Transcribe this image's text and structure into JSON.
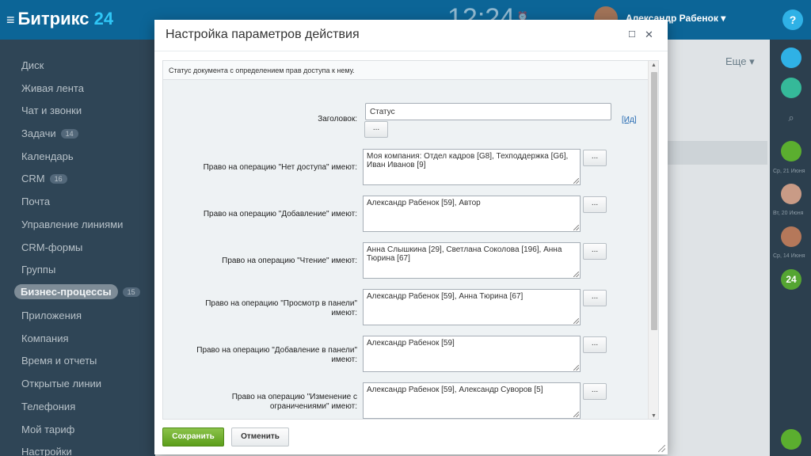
{
  "app": {
    "logo_text": "Битрикс",
    "logo_num": "24",
    "clock": "12:24",
    "user_name": "Александр Рабенок",
    "help": "?",
    "more_label": "Еще"
  },
  "sidebar": {
    "items": [
      {
        "label": "Диск",
        "badge": ""
      },
      {
        "label": "Живая лента",
        "badge": ""
      },
      {
        "label": "Чат и звонки",
        "badge": ""
      },
      {
        "label": "Задачи",
        "badge": "14"
      },
      {
        "label": "Календарь",
        "badge": ""
      },
      {
        "label": "CRM",
        "badge": "16"
      },
      {
        "label": "Почта",
        "badge": ""
      },
      {
        "label": "Управление линиями",
        "badge": ""
      },
      {
        "label": "CRM-формы",
        "badge": ""
      },
      {
        "label": "Группы",
        "badge": ""
      },
      {
        "label": "Бизнес-процессы",
        "badge": "15"
      },
      {
        "label": "Приложения",
        "badge": ""
      },
      {
        "label": "Компания",
        "badge": ""
      },
      {
        "label": "Время и отчеты",
        "badge": ""
      },
      {
        "label": "Открытые линии",
        "badge": ""
      },
      {
        "label": "Телефония",
        "badge": ""
      },
      {
        "label": "Мой тариф",
        "badge": ""
      },
      {
        "label": "Настройки",
        "badge": ""
      }
    ]
  },
  "rightbar": {
    "dates": [
      "Ср, 21 Июня",
      "Вт, 20 Июня",
      "Ср, 14 Июня"
    ],
    "brand_badge": "24"
  },
  "modal": {
    "title": "Настройка параметров действия",
    "description": "Статус документа с определением прав доступа к нему.",
    "title_field": {
      "label": "Заголовок:",
      "value": "Статус",
      "dots": "...",
      "link": "[Ид]"
    },
    "rows": [
      {
        "label": "Право на операцию \"Нет доступа\" имеют:",
        "value": "Моя компания: Отдел кадров [G8], Техподдержка [G6], Иван Иванов [9]",
        "dots": "..."
      },
      {
        "label": "Право на операцию \"Добавление\" имеют:",
        "value": "Александр Рабенок [59], Автор",
        "dots": "..."
      },
      {
        "label": "Право на операцию \"Чтение\" имеют:",
        "value": "Анна Слышкина [29], Светлана Соколова [196], Анна Тюрина [67]",
        "dots": "..."
      },
      {
        "label": "Право на операцию \"Просмотр в панели\" имеют:",
        "value": "Александр Рабенок [59], Анна Тюрина [67]",
        "dots": "..."
      },
      {
        "label": "Право на операцию \"Добавление в панели\" имеют:",
        "value": "Александр Рабенок [59]",
        "dots": "..."
      },
      {
        "label": "Право на операцию \"Изменение с ограничениями\" имеют:",
        "value": "Александр Рабенок [59], Александр Суворов [5]",
        "dots": "..."
      }
    ],
    "save_label": "Сохранить",
    "cancel_label": "Отменить"
  }
}
